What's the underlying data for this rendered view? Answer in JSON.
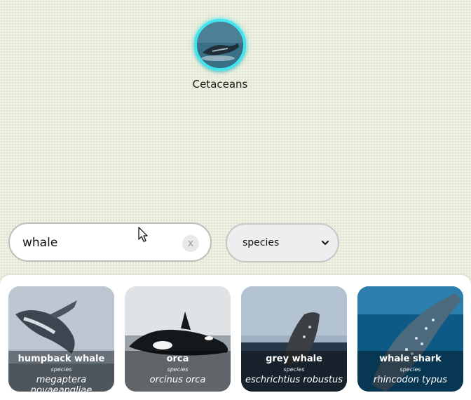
{
  "selected_taxon": {
    "label": "Cetaceans",
    "icon": "whale-photo",
    "accent_color": "#3fe6ef"
  },
  "search": {
    "value": "whale",
    "clear_label": "x"
  },
  "rank_filter": {
    "selected": "species"
  },
  "results": [
    {
      "name": "humpback whale",
      "rank": "species",
      "scientific": "megaptera novaeangliae"
    },
    {
      "name": "orca",
      "rank": "species",
      "scientific": "orcinus orca"
    },
    {
      "name": "grey whale",
      "rank": "species",
      "scientific": "eschrichtius robustus"
    },
    {
      "name": "whale shark",
      "rank": "species",
      "scientific": "rhincodon typus"
    }
  ]
}
